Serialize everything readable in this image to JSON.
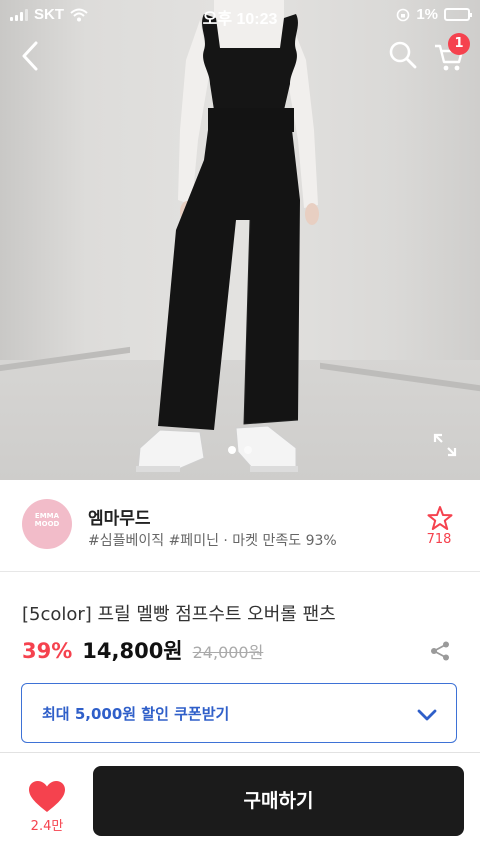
{
  "status_bar": {
    "carrier": "SKT",
    "time": "오후 10:23",
    "battery": "1%"
  },
  "header": {
    "cart_count": "1"
  },
  "gallery": {
    "page_count": 2,
    "current_page": 1
  },
  "shop": {
    "logo_text": [
      "EMMA MOOD"
    ],
    "name": "엠마무드",
    "tags": "#심플베이직 #페미닌 · 마켓 만족도 93%",
    "favorite_count": "718"
  },
  "product": {
    "title": "[5color] 프릴 멜빵 점프수트 오버롤 팬츠",
    "discount": "39%",
    "price": "14,800원",
    "original_price": "24,000원"
  },
  "coupon": {
    "label": "최대 5,000원 할인 쿠폰받기"
  },
  "bottom_bar": {
    "like_count": "2.4만",
    "buy_label": "구매하기"
  },
  "colors": {
    "accent_red": "#f5424e",
    "coupon_blue": "#2f5fc9",
    "buy_button": "#1b1b1b"
  }
}
